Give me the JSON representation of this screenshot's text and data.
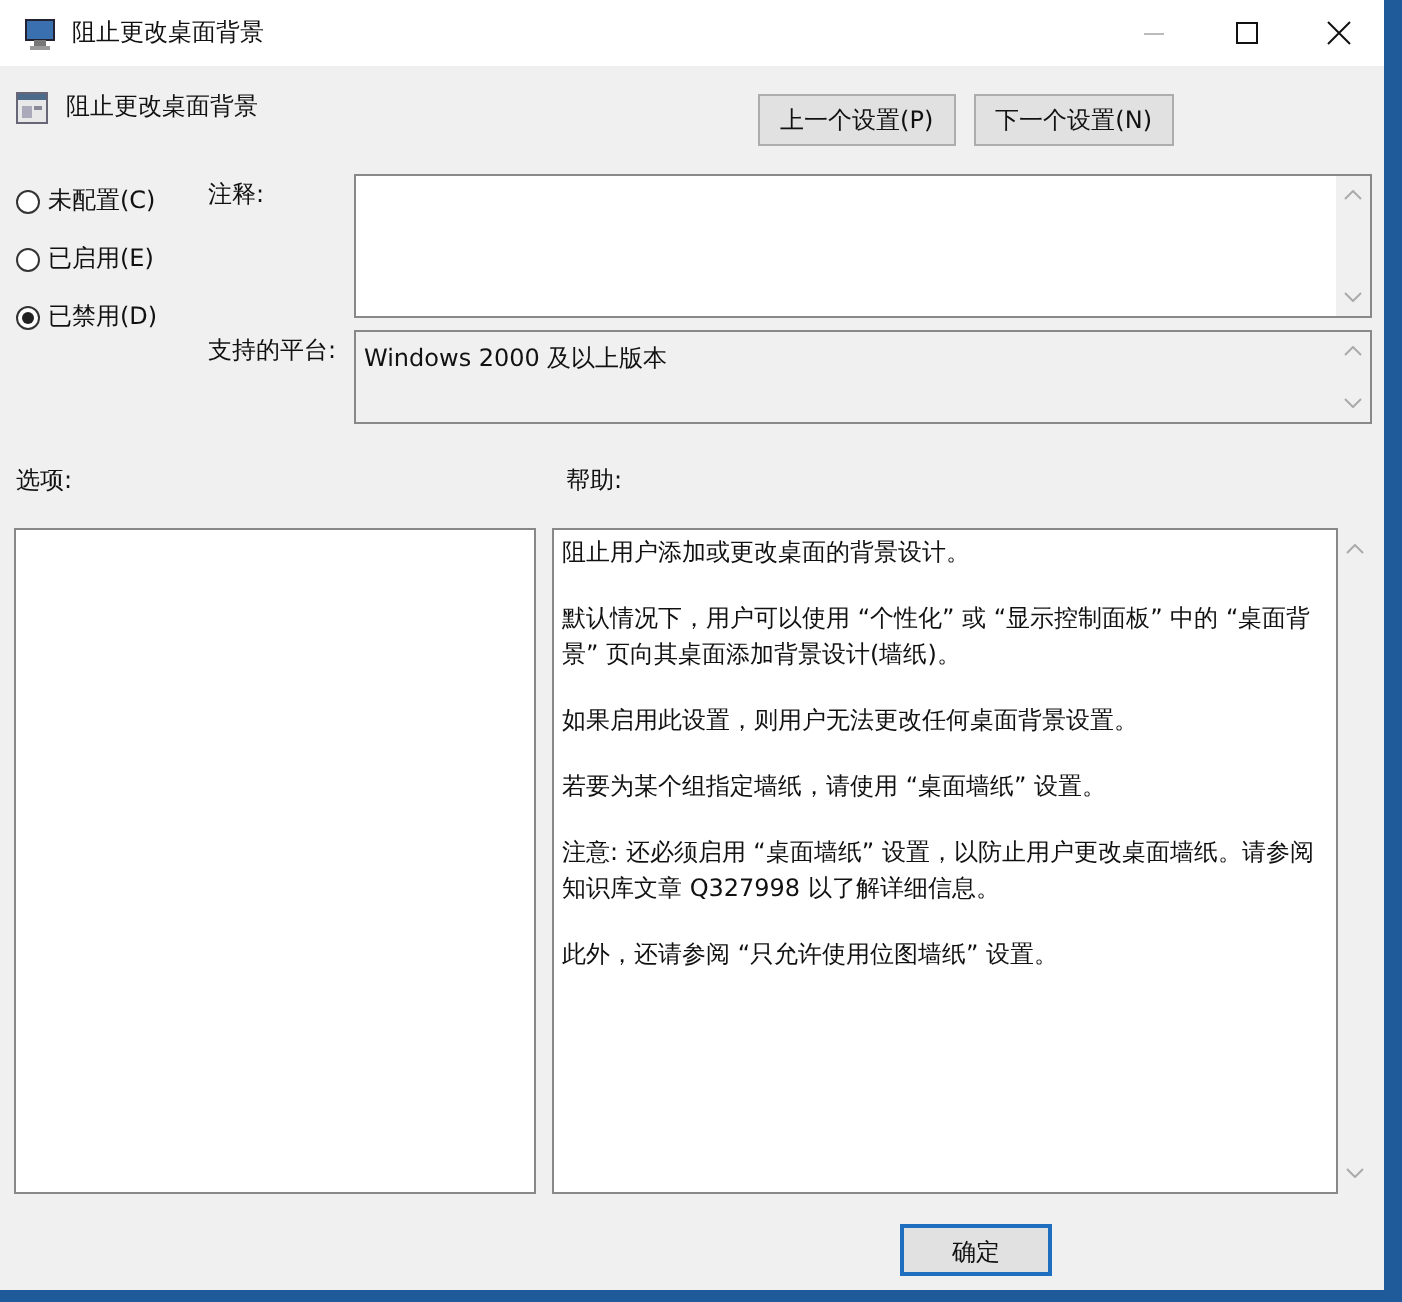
{
  "window": {
    "title": "阻止更改桌面背景"
  },
  "policy": {
    "name": "阻止更改桌面背景"
  },
  "nav_buttons": [
    "上一个设置(P)",
    "下一个设置(N)"
  ],
  "state_options": [
    {
      "label": "未配置(C)",
      "selected": false
    },
    {
      "label": "已启用(E)",
      "selected": false
    },
    {
      "label": "已禁用(D)",
      "selected": true
    }
  ],
  "comment": {
    "label": "注释:"
  },
  "platform": {
    "label": "支持的平台:",
    "value": "Windows 2000 及以上版本"
  },
  "options": {
    "label": "选项:"
  },
  "help": {
    "label": "帮助:",
    "paragraphs": [
      "阻止用户添加或更改桌面的背景设计。",
      "默认情况下，用户可以使用 “个性化” 或 “显示控制面板” 中的 “桌面背景” 页向其桌面添加背景设计(墙纸)。",
      "如果启用此设置，则用户无法更改任何桌面背景设置。",
      "若要为某个组指定墙纸，请使用 “桌面墙纸” 设置。",
      "注意: 还必须启用 “桌面墙纸” 设置，以防止用户更改桌面墙纸。请参阅知识库文章 Q327998 以了解详细信息。",
      "此外，还请参阅 “只允许使用位图墙纸” 设置。"
    ]
  },
  "buttons": [
    "确定"
  ]
}
